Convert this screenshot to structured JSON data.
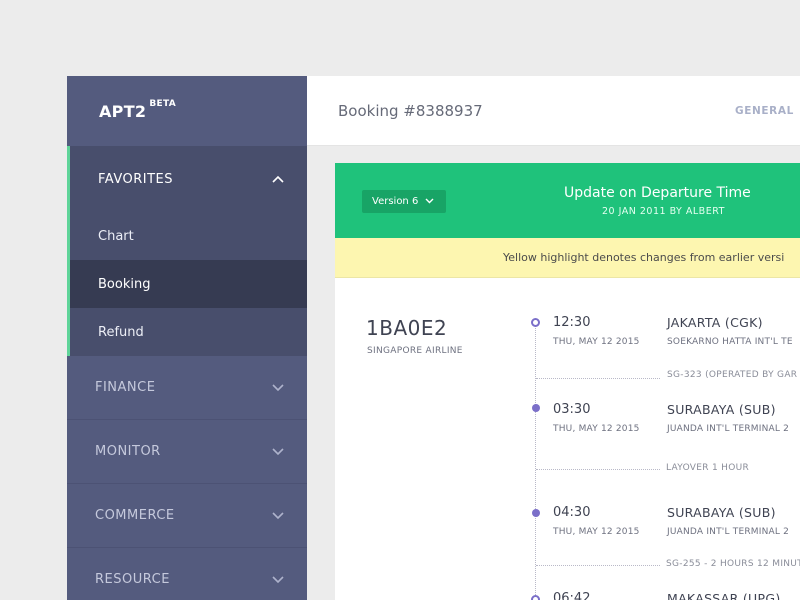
{
  "sidebar": {
    "logo": "APT2",
    "logo_badge": "BETA",
    "favorites": {
      "label": "FAVORITES",
      "items": [
        {
          "label": "Chart"
        },
        {
          "label": "Booking"
        },
        {
          "label": "Refund"
        }
      ]
    },
    "groups": [
      {
        "label": "FINANCE"
      },
      {
        "label": "MONITOR"
      },
      {
        "label": "COMMERCE"
      },
      {
        "label": "RESOURCE"
      }
    ]
  },
  "header": {
    "title": "Booking #8388937",
    "tab_general": "GENERAL"
  },
  "update_banner": {
    "version_label": "Version 6",
    "title": "Update on Departure Time",
    "subtitle": "20 JAN 2011 BY ALBERT"
  },
  "highlight_banner": {
    "text": "Yellow highlight denotes changes from earlier versi"
  },
  "booking": {
    "pnr": "1BA0E2",
    "airline": "SINGAPORE AIRLINE"
  },
  "timeline": [
    {
      "time": "12:30",
      "date": "THU, MAY 12 2015",
      "city": "JAKARTA (CGK)",
      "airport": "SOEKARNO HATTA INT'L TE"
    },
    {
      "note": "SG-323 (OPERATED BY GAR"
    },
    {
      "time": "03:30",
      "date": "THU, MAY 12 2015",
      "city": "SURABAYA (SUB)",
      "airport": "JUANDA INT'L TERMINAL 2"
    },
    {
      "note": "LAYOVER 1 HOUR"
    },
    {
      "time": "04:30",
      "date": "THU, MAY 12 2015",
      "city": "SURABAYA (SUB)",
      "airport": "JUANDA INT'L TERMINAL 2"
    },
    {
      "note": "SG-255 - 2 HOURS 12 MINUT"
    },
    {
      "time": "06:42",
      "city": "MAKASSAR (UPG)"
    }
  ],
  "colors": {
    "sidebar_bg": "#545b7e",
    "accent_green": "#1fc27b",
    "highlight_yellow": "#fdf6b0",
    "timeline_purple": "#7b6fc9"
  }
}
